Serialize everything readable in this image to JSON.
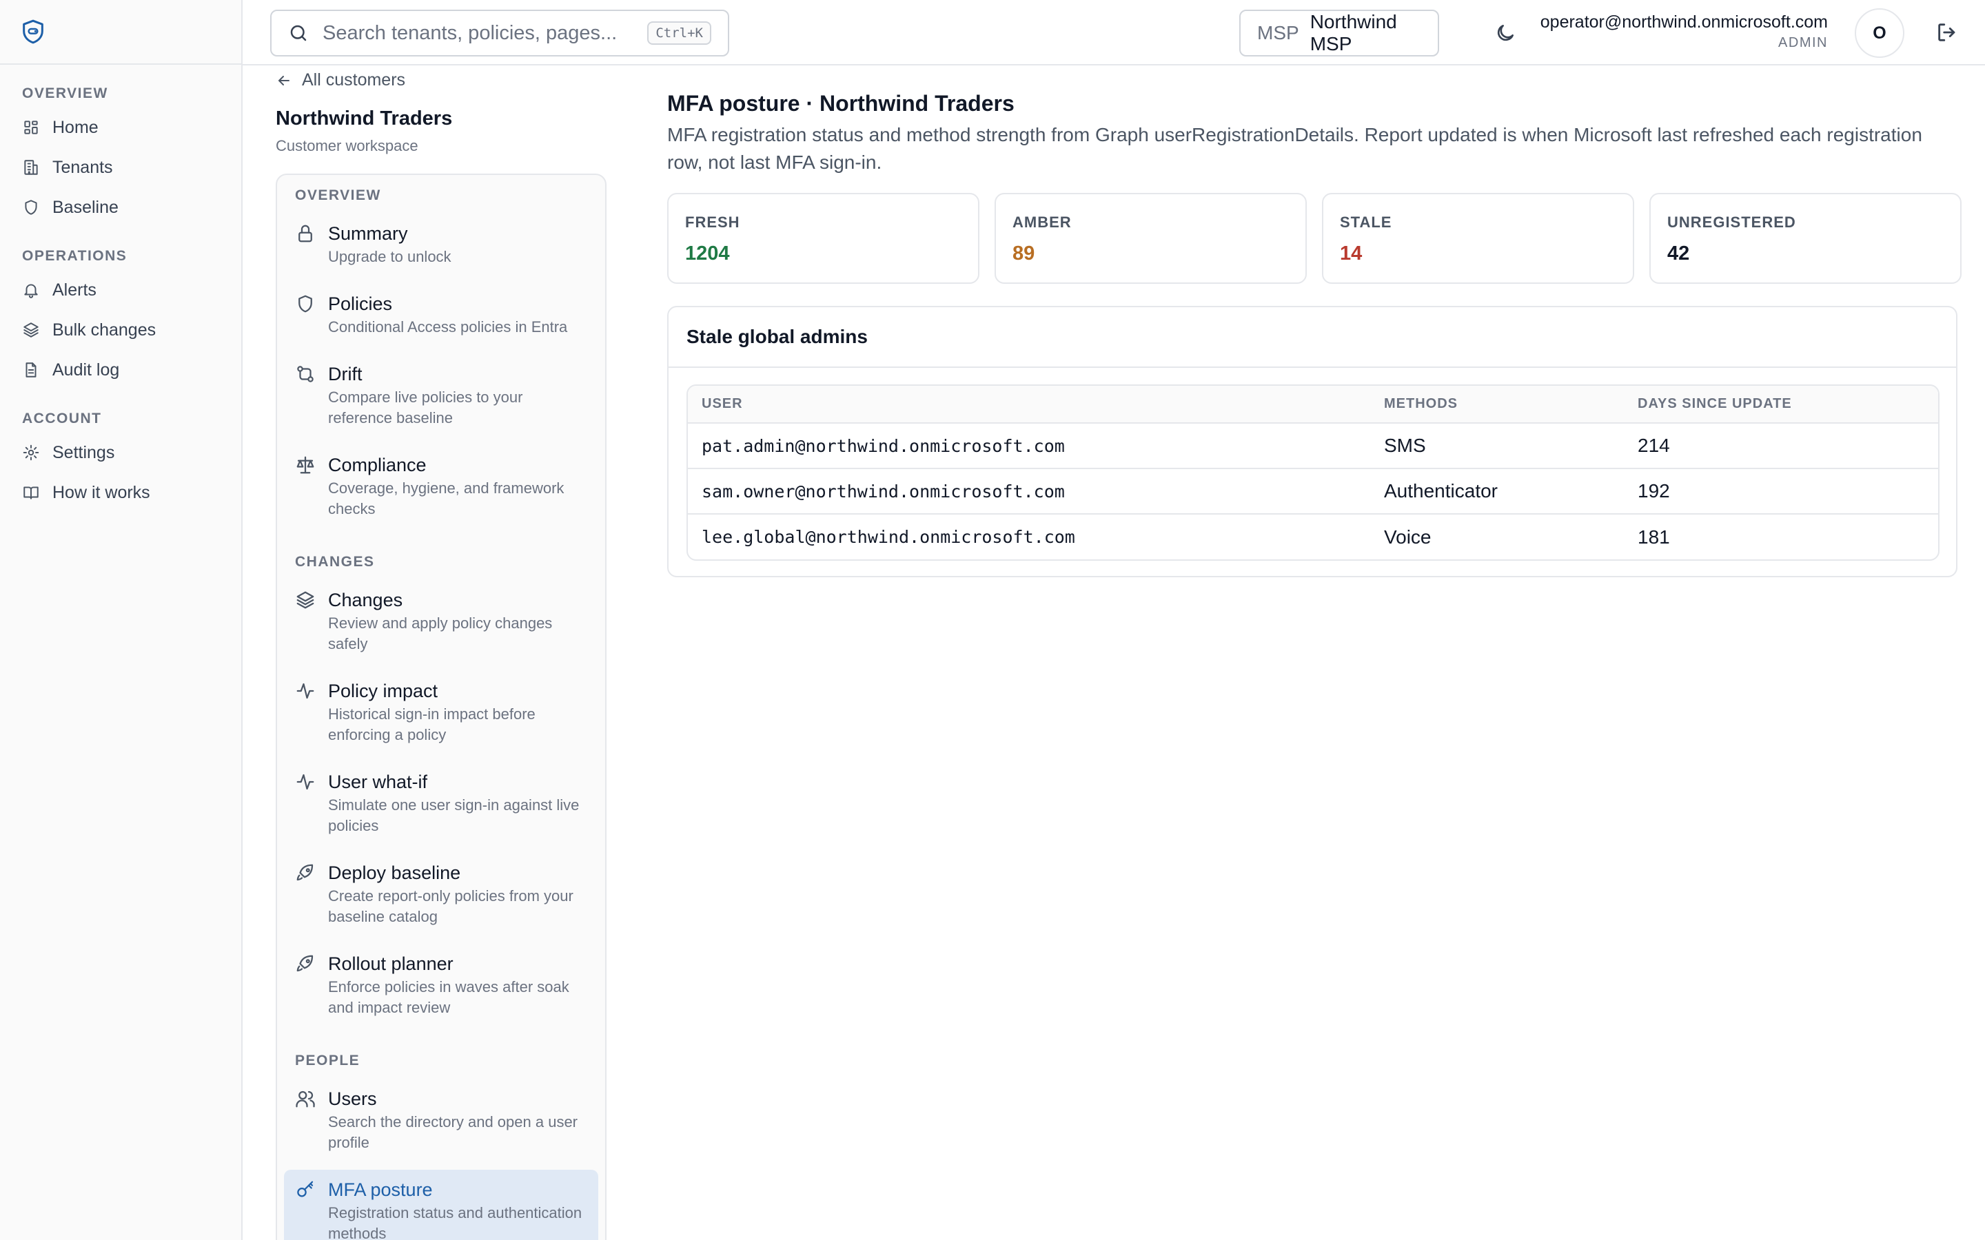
{
  "sidebar": {
    "sections": [
      {
        "heading": "OVERVIEW",
        "items": [
          {
            "label": "Home",
            "icon": "grid-icon"
          },
          {
            "label": "Tenants",
            "icon": "building-icon"
          },
          {
            "label": "Baseline",
            "icon": "shield-icon"
          }
        ]
      },
      {
        "heading": "OPERATIONS",
        "items": [
          {
            "label": "Alerts",
            "icon": "bell-icon"
          },
          {
            "label": "Bulk changes",
            "icon": "layers-icon"
          },
          {
            "label": "Audit log",
            "icon": "document-icon"
          }
        ]
      },
      {
        "heading": "ACCOUNT",
        "items": [
          {
            "label": "Settings",
            "icon": "gear-icon"
          },
          {
            "label": "How it works",
            "icon": "book-icon"
          }
        ]
      }
    ]
  },
  "topbar": {
    "search_placeholder": "Search tenants, policies, pages...",
    "search_shortcut": "Ctrl+K",
    "msp_prefix": "MSP",
    "msp_name": "Northwind MSP",
    "user_email": "operator@northwind.onmicrosoft.com",
    "user_role": "ADMIN",
    "avatar_initial": "O"
  },
  "customer": {
    "back_label": "All customers",
    "name": "Northwind Traders",
    "subtitle": "Customer workspace",
    "nav": [
      {
        "heading": "OVERVIEW",
        "items": [
          {
            "title": "Summary",
            "desc": "Upgrade to unlock",
            "icon": "lock-icon"
          },
          {
            "title": "Policies",
            "desc": "Conditional Access policies in Entra",
            "icon": "shield-icon"
          },
          {
            "title": "Drift",
            "desc": "Compare live policies to your reference baseline",
            "icon": "git-compare-icon"
          },
          {
            "title": "Compliance",
            "desc": "Coverage, hygiene, and framework checks",
            "icon": "scale-icon"
          }
        ]
      },
      {
        "heading": "CHANGES",
        "items": [
          {
            "title": "Changes",
            "desc": "Review and apply policy changes safely",
            "icon": "layers-icon"
          },
          {
            "title": "Policy impact",
            "desc": "Historical sign-in impact before enforcing a policy",
            "icon": "activity-icon"
          },
          {
            "title": "User what-if",
            "desc": "Simulate one user sign-in against live policies",
            "icon": "activity-icon"
          },
          {
            "title": "Deploy baseline",
            "desc": "Create report-only policies from your baseline catalog",
            "icon": "rocket-icon"
          },
          {
            "title": "Rollout planner",
            "desc": "Enforce policies in waves after soak and impact review",
            "icon": "rocket-icon"
          }
        ]
      },
      {
        "heading": "PEOPLE",
        "items": [
          {
            "title": "Users",
            "desc": "Search the directory and open a user profile",
            "icon": "users-icon"
          },
          {
            "title": "MFA posture",
            "desc": "Registration status and authentication methods",
            "icon": "key-icon",
            "active": true
          }
        ]
      }
    ]
  },
  "main": {
    "title": "MFA posture · Northwind Traders",
    "description": "MFA registration status and method strength from Graph userRegistrationDetails. Report updated is when Microsoft last refreshed each registration row, not last MFA sign-in.",
    "stats": [
      {
        "label": "FRESH",
        "value": "1204",
        "color": "#1f7a45"
      },
      {
        "label": "AMBER",
        "value": "89",
        "color": "#b86e23"
      },
      {
        "label": "STALE",
        "value": "14",
        "color": "#b93a2e"
      },
      {
        "label": "UNREGISTERED",
        "value": "42",
        "color": "#111827"
      }
    ],
    "panel_title": "Stale global admins",
    "table": {
      "headers": [
        "USER",
        "METHODS",
        "DAYS SINCE UPDATE"
      ],
      "rows": [
        [
          "pat.admin@northwind.onmicrosoft.com",
          "SMS",
          "214"
        ],
        [
          "sam.owner@northwind.onmicrosoft.com",
          "Authenticator",
          "192"
        ],
        [
          "lee.global@northwind.onmicrosoft.com",
          "Voice",
          "181"
        ]
      ]
    }
  },
  "colors": {
    "accent": "#1d5fa8",
    "active_bg": "#e0e9f5"
  }
}
